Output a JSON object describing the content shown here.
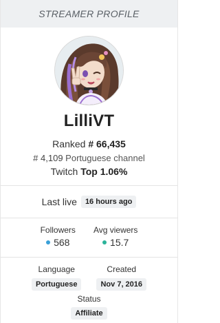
{
  "header": {
    "title": "STREAMER PROFILE"
  },
  "profile": {
    "name": "LilliVT",
    "ranked_prefix": "Ranked",
    "ranked_value": "# 66,435",
    "channel_rank_value": "# 4,109",
    "channel_rank_suffix": "Portuguese channel",
    "twitch_prefix": "Twitch",
    "twitch_value": "Top 1.06%"
  },
  "last_live": {
    "label": "Last live",
    "value": "16 hours ago"
  },
  "stats": {
    "followers": {
      "label": "Followers",
      "value": "568",
      "color": "#3aa0d8"
    },
    "avg_viewers": {
      "label": "Avg viewers",
      "value": "15.7",
      "color": "#2bb39a"
    }
  },
  "meta": {
    "language": {
      "label": "Language",
      "value": "Portuguese"
    },
    "created": {
      "label": "Created",
      "value": "Nov 7, 2016"
    },
    "status": {
      "label": "Status",
      "value": "Affiliate"
    }
  }
}
